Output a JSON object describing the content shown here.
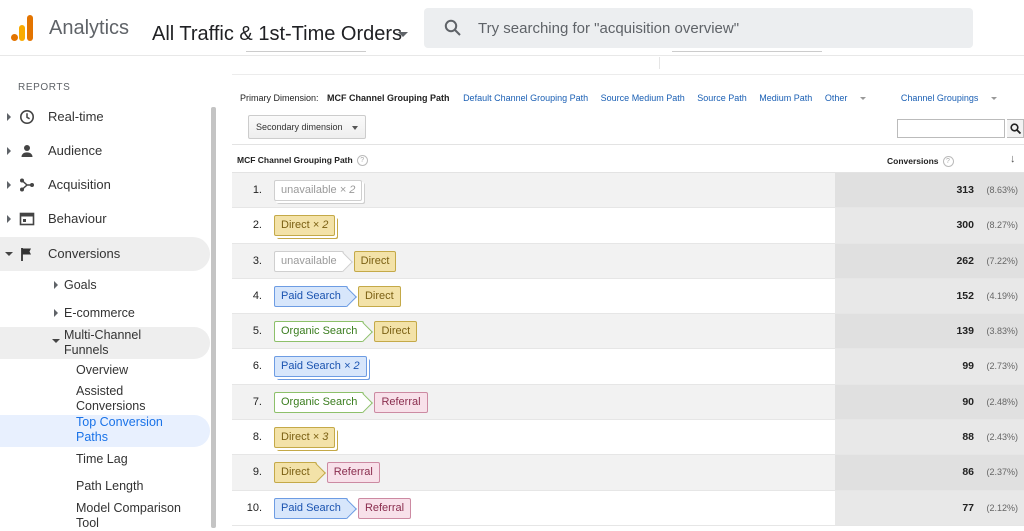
{
  "header": {
    "app_name": "Analytics",
    "view_title": "All Traffic & 1st-Time Orders",
    "search_placeholder": "Try searching for \"acquisition overview\""
  },
  "sidebar": {
    "section_label": "REPORTS",
    "items": [
      {
        "label": "Real-time",
        "icon": "clock-icon"
      },
      {
        "label": "Audience",
        "icon": "person-icon"
      },
      {
        "label": "Acquisition",
        "icon": "acquisition-icon"
      },
      {
        "label": "Behaviour",
        "icon": "behaviour-icon"
      },
      {
        "label": "Conversions",
        "icon": "flag-icon"
      }
    ],
    "conversions_sub": {
      "goals": "Goals",
      "ecommerce": "E-commerce",
      "mcf": "Multi-Channel Funnels",
      "overview": "Overview",
      "assisted": "Assisted Conversions",
      "top_paths": "Top Conversion Paths",
      "time_lag": "Time Lag",
      "path_length": "Path Length",
      "model_tool": "Model Comparison Tool"
    }
  },
  "dimensions": {
    "label": "Primary Dimension:",
    "current": "MCF Channel Grouping Path",
    "links": [
      "Default Channel Grouping Path",
      "Source Medium Path",
      "Source Path",
      "Medium Path"
    ],
    "other": "Other",
    "channel_groupings": "Channel Groupings",
    "secondary": "Secondary dimension"
  },
  "table": {
    "col_path": "MCF Channel Grouping Path",
    "col_conversions": "Conversions",
    "help": "?",
    "sort_arrow": "↓",
    "rows": [
      {
        "n": "1.",
        "chips": [
          {
            "text": "unavailable",
            "mult": "× 2",
            "type": "unavail"
          }
        ],
        "value": "313",
        "pct": "(8.63%)"
      },
      {
        "n": "2.",
        "chips": [
          {
            "text": "Direct",
            "mult": "× 2",
            "type": "direct"
          }
        ],
        "value": "300",
        "pct": "(8.27%)"
      },
      {
        "n": "3.",
        "chips": [
          {
            "text": "unavailable",
            "type": "unavail"
          },
          {
            "text": "Direct",
            "type": "direct"
          }
        ],
        "value": "262",
        "pct": "(7.22%)"
      },
      {
        "n": "4.",
        "chips": [
          {
            "text": "Paid Search",
            "type": "paid"
          },
          {
            "text": "Direct",
            "type": "direct"
          }
        ],
        "value": "152",
        "pct": "(4.19%)"
      },
      {
        "n": "5.",
        "chips": [
          {
            "text": "Organic Search",
            "type": "organic"
          },
          {
            "text": "Direct",
            "type": "direct"
          }
        ],
        "value": "139",
        "pct": "(3.83%)"
      },
      {
        "n": "6.",
        "chips": [
          {
            "text": "Paid Search",
            "mult": "× 2",
            "type": "paid"
          }
        ],
        "value": "99",
        "pct": "(2.73%)"
      },
      {
        "n": "7.",
        "chips": [
          {
            "text": "Organic Search",
            "type": "organic"
          },
          {
            "text": "Referral",
            "type": "referral"
          }
        ],
        "value": "90",
        "pct": "(2.48%)"
      },
      {
        "n": "8.",
        "chips": [
          {
            "text": "Direct",
            "mult": "× 3",
            "type": "direct"
          }
        ],
        "value": "88",
        "pct": "(2.43%)"
      },
      {
        "n": "9.",
        "chips": [
          {
            "text": "Direct",
            "type": "direct"
          },
          {
            "text": "Referral",
            "type": "referral"
          }
        ],
        "value": "86",
        "pct": "(2.37%)"
      },
      {
        "n": "10.",
        "chips": [
          {
            "text": "Paid Search",
            "type": "paid"
          },
          {
            "text": "Referral",
            "type": "referral"
          }
        ],
        "value": "77",
        "pct": "(2.12%)"
      }
    ]
  }
}
